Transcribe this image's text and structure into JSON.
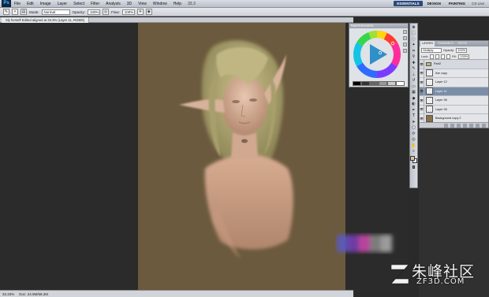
{
  "app": {
    "logo_text": "Ps",
    "zoom": "33.3",
    "menu": [
      "File",
      "Edit",
      "Image",
      "Layer",
      "Select",
      "Filter",
      "Analysis",
      "3D",
      "View",
      "Window",
      "Help"
    ],
    "workspaces": [
      "ESSENTIALS",
      "DESIGN",
      "PAINTING"
    ],
    "active_workspace": "ESSENTIALS",
    "cs_live": "CS Live"
  },
  "options": {
    "mode_label": "Mode:",
    "mode_value": "Normal",
    "opacity_label": "Opacity:",
    "opacity_value": "100%",
    "flow_label": "Flow:",
    "flow_value": "100%"
  },
  "document": {
    "tab_title": "Sly herself Edited-aligned at 33.3% (Layer 11, RGB/8)"
  },
  "status": {
    "zoom": "33.33%",
    "doc_size": "Doc: 24.9M/58.2M"
  },
  "color_panel": {
    "title": "PAINTER/WHEEL",
    "hue_color": "#2f8fc7",
    "swatches": [
      "#000000",
      "#333333",
      "#666666",
      "#999999",
      "#cccccc",
      "#ffffff"
    ]
  },
  "layers_panel": {
    "tabs": [
      "LAYERS",
      "CHANNELS",
      "PATHS"
    ],
    "active_tab": "LAYERS",
    "blend_mode": "Multiply",
    "opacity_label": "Opacity:",
    "opacity_value": "100%",
    "lock_label": "Lock:",
    "fill_label": "Fill:",
    "fill_value": "100%",
    "layers": [
      {
        "name": "Part2",
        "group": true,
        "selected": false
      },
      {
        "name": "line copy",
        "group": false,
        "selected": false
      },
      {
        "name": "Layer 12",
        "group": false,
        "selected": false
      },
      {
        "name": "Layer 11",
        "group": false,
        "selected": true
      },
      {
        "name": "Layer 36",
        "group": false,
        "selected": false
      },
      {
        "name": "Layer 35",
        "group": false,
        "selected": false
      },
      {
        "name": "Background copy 2",
        "group": false,
        "selected": false
      }
    ]
  },
  "colors": {
    "canvas_bg": "#6c5a3e",
    "foreground": "#d6c3a3",
    "background": "#ffffff",
    "selected_layer": "#7a8ea8"
  },
  "watermark": {
    "cn": "朱峰社区",
    "en": "ZF3D.COM"
  }
}
